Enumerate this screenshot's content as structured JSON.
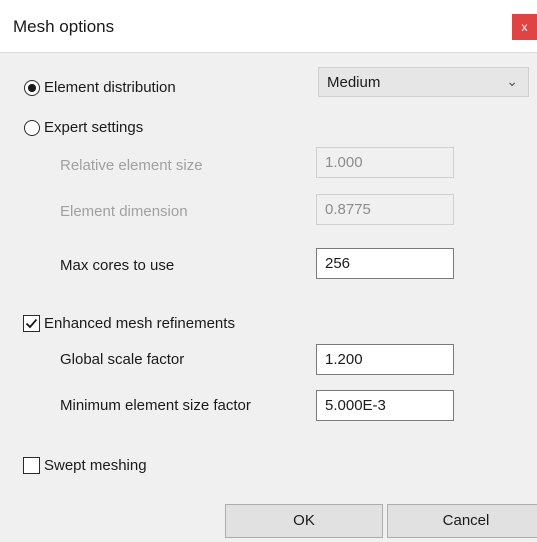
{
  "window": {
    "title": "Mesh options",
    "close_label": "x"
  },
  "options": {
    "element_distribution_label": "Element distribution",
    "expert_settings_label": "Expert settings",
    "selected_mode": "Element distribution",
    "distribution": {
      "selected": "Medium"
    }
  },
  "fields": {
    "relative_element_size": {
      "label": "Relative element size",
      "value": "1.000"
    },
    "element_dimension": {
      "label": "Element dimension",
      "value": "0.8775"
    },
    "max_cores": {
      "label": "Max cores to use",
      "value": "256"
    },
    "global_scale_factor": {
      "label": "Global scale factor",
      "value": "1.200"
    },
    "minimum_element_size_factor": {
      "label": "Minimum element size factor",
      "value": "5.000E-3"
    }
  },
  "checkboxes": {
    "enhanced_mesh_refinements": {
      "label": "Enhanced mesh refinements",
      "checked": true
    },
    "swept_meshing": {
      "label": "Swept meshing",
      "checked": false
    }
  },
  "buttons": {
    "ok_label": "OK",
    "cancel_label": "Cancel"
  },
  "colors": {
    "close_button": "#e04343",
    "dialog_bg": "#f0f0f0"
  }
}
